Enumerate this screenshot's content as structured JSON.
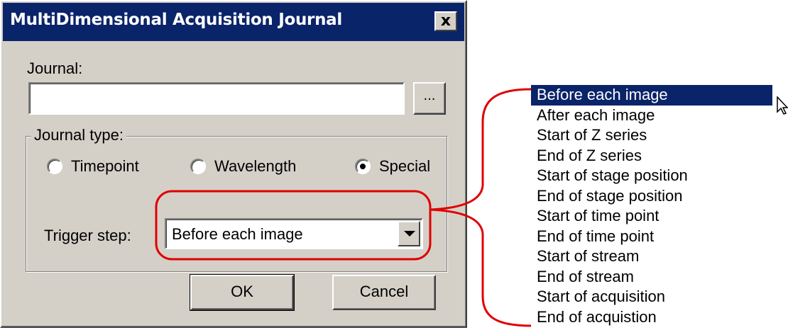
{
  "window": {
    "title": "MultiDimensional Acquisition Journal",
    "close_label": "x"
  },
  "journal": {
    "label": "Journal:",
    "value": "",
    "browse_label": "..."
  },
  "journal_type": {
    "label": "Journal type:",
    "options": [
      {
        "label": "Timepoint",
        "checked": false
      },
      {
        "label": "Wavelength",
        "checked": false
      },
      {
        "label": "Special",
        "checked": true
      }
    ]
  },
  "trigger": {
    "label": "Trigger step:",
    "value": "Before each image"
  },
  "buttons": {
    "ok_label": "OK",
    "cancel_label": "Cancel"
  },
  "dropdown": {
    "selected_index": 0,
    "items": [
      "Before each image",
      "After each image",
      "Start of Z series",
      "End of Z series",
      "Start of stage position",
      "End of stage position",
      "Start of time point",
      "End of time point",
      "Start of stream",
      "End of stream",
      "Start of acquisition",
      "End of acquistion"
    ]
  },
  "colors": {
    "titlebar": "#0a246a",
    "dialog_face": "#d4d0c8",
    "highlight_annotation": "#e00000",
    "selection": "#0a246a"
  }
}
